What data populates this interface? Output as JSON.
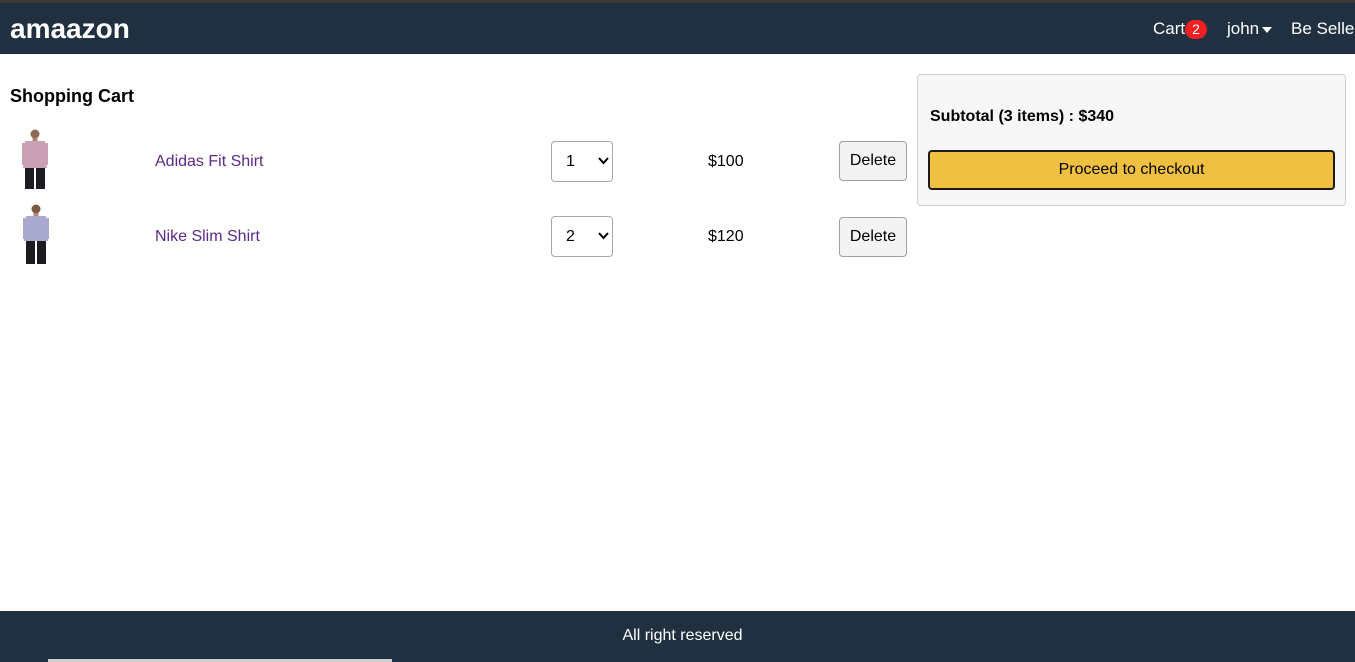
{
  "header": {
    "brand": "amaazon",
    "cart_label": "Cart",
    "cart_count": "2",
    "user_label": "john",
    "seller_label": "Be Seller"
  },
  "main": {
    "title": "Shopping Cart",
    "items": [
      {
        "name": "Adidas Fit Shirt",
        "quantity": "1",
        "price": "$100",
        "delete_label": "Delete",
        "shirt_color": "#c9a0b4"
      },
      {
        "name": "Nike Slim Shirt",
        "quantity": "2",
        "price": "$120",
        "delete_label": "Delete",
        "shirt_color": "#a9a9cf"
      }
    ]
  },
  "summary": {
    "subtotal_text": "Subtotal (3 items) : $340",
    "checkout_label": "Proceed to checkout"
  },
  "footer": {
    "text": "All right reserved"
  },
  "colors": {
    "nav_bg": "#203040",
    "accent": "#f0c040",
    "badge": "#f02020",
    "link": "#5b2a86"
  }
}
